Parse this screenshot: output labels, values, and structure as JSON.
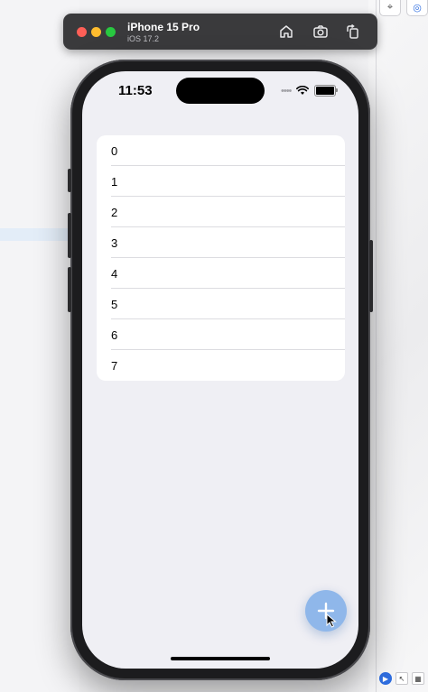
{
  "simulator": {
    "device_name": "iPhone 15 Pro",
    "os_version": "iOS 17.2",
    "toolbar_icons": [
      "home-icon",
      "screenshot-icon",
      "rotate-icon"
    ]
  },
  "status_bar": {
    "time": "11:53",
    "icons": [
      "cellular-dots-icon",
      "wifi-icon",
      "battery-icon"
    ]
  },
  "list": {
    "items": [
      {
        "label": "0"
      },
      {
        "label": "1"
      },
      {
        "label": "2"
      },
      {
        "label": "3"
      },
      {
        "label": "4"
      },
      {
        "label": "5"
      },
      {
        "label": "6"
      },
      {
        "label": "7"
      }
    ]
  },
  "fab": {
    "icon": "plus-icon",
    "color": "#8fb7ea"
  },
  "colors": {
    "screen_background": "#efeff4",
    "titlebar": "#3a3a3c",
    "accent": "#2e6de0"
  }
}
